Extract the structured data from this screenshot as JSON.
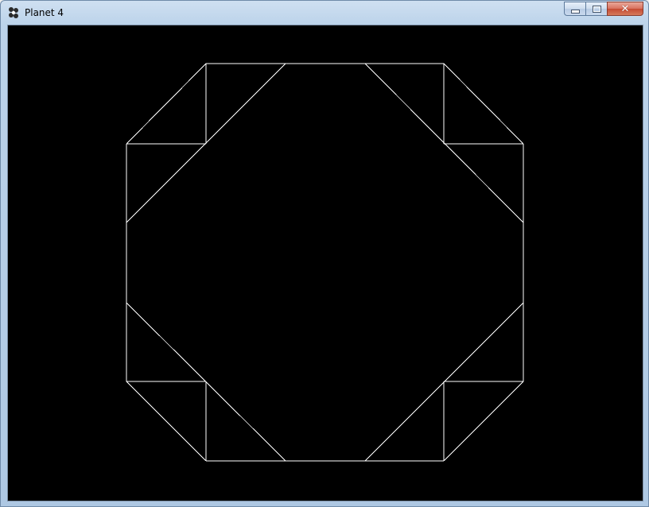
{
  "window": {
    "title": "Planet 4",
    "icon": "app-icon",
    "buttons": {
      "minimize": "minimize-icon",
      "maximize": "maximize-icon",
      "close": "close-icon",
      "close_glyph": "✕"
    }
  },
  "canvas": {
    "background": "#000000",
    "stroke": "#ffffff",
    "shape": "octagon-wireframe"
  },
  "colors": {
    "titlebar": "#bcd3ea",
    "close_button": "#c54a32"
  }
}
